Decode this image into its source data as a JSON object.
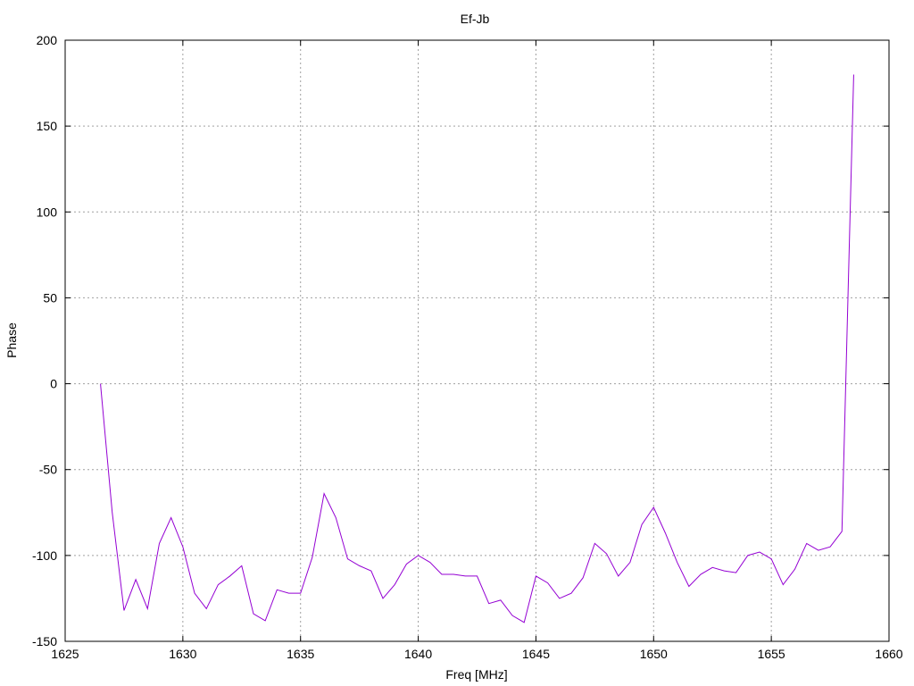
{
  "chart_data": {
    "type": "line",
    "title": "Ef-Jb",
    "xlabel": "Freq [MHz]",
    "ylabel": "Phase",
    "xlim": [
      1625,
      1660
    ],
    "ylim": [
      -150,
      200
    ],
    "xticks": [
      1625,
      1630,
      1635,
      1640,
      1645,
      1650,
      1655,
      1660
    ],
    "yticks": [
      -150,
      -100,
      -50,
      0,
      50,
      100,
      150,
      200
    ],
    "grid": true,
    "line_color": "#9400d3",
    "series": [
      {
        "x": [
          1626.5,
          1627.0,
          1627.5,
          1628.0,
          1628.5,
          1629.0,
          1629.5,
          1630.0,
          1630.5,
          1631.0,
          1631.5,
          1632.0,
          1632.5,
          1633.0,
          1633.5,
          1634.0,
          1634.5,
          1635.0,
          1635.5,
          1636.0,
          1636.5,
          1637.0,
          1637.5,
          1638.0,
          1638.5,
          1639.0,
          1639.5,
          1640.0,
          1640.5,
          1641.0,
          1641.5,
          1642.0,
          1642.5,
          1643.0,
          1643.5,
          1644.0,
          1644.5,
          1645.0,
          1645.5,
          1646.0,
          1646.5,
          1647.0,
          1647.5,
          1648.0,
          1648.5,
          1649.0,
          1649.5,
          1650.0,
          1650.5,
          1651.0,
          1651.5,
          1652.0,
          1652.5,
          1653.0,
          1653.5,
          1654.0,
          1654.5,
          1655.0,
          1655.5,
          1656.0,
          1656.5,
          1657.0,
          1657.5,
          1658.0,
          1658.5
        ],
        "y": [
          0,
          -75,
          -132,
          -114,
          -131,
          -93,
          -78,
          -95,
          -122,
          -131,
          -117,
          -112,
          -106,
          -134,
          -138,
          -120,
          -122,
          -122,
          -101,
          -64,
          -78,
          -102,
          -106,
          -109,
          -125,
          -117,
          -105,
          -100,
          -104,
          -111,
          -111,
          -112,
          -112,
          -128,
          -126,
          -135,
          -139,
          -112,
          -116,
          -125,
          -122,
          -113,
          -93,
          -99,
          -112,
          -104,
          -82,
          -72,
          -87,
          -104,
          -118,
          -111,
          -107,
          -109,
          -110,
          -100,
          -98,
          -102,
          -117,
          -108,
          -93,
          -97,
          -95,
          -86,
          180
        ]
      }
    ]
  }
}
